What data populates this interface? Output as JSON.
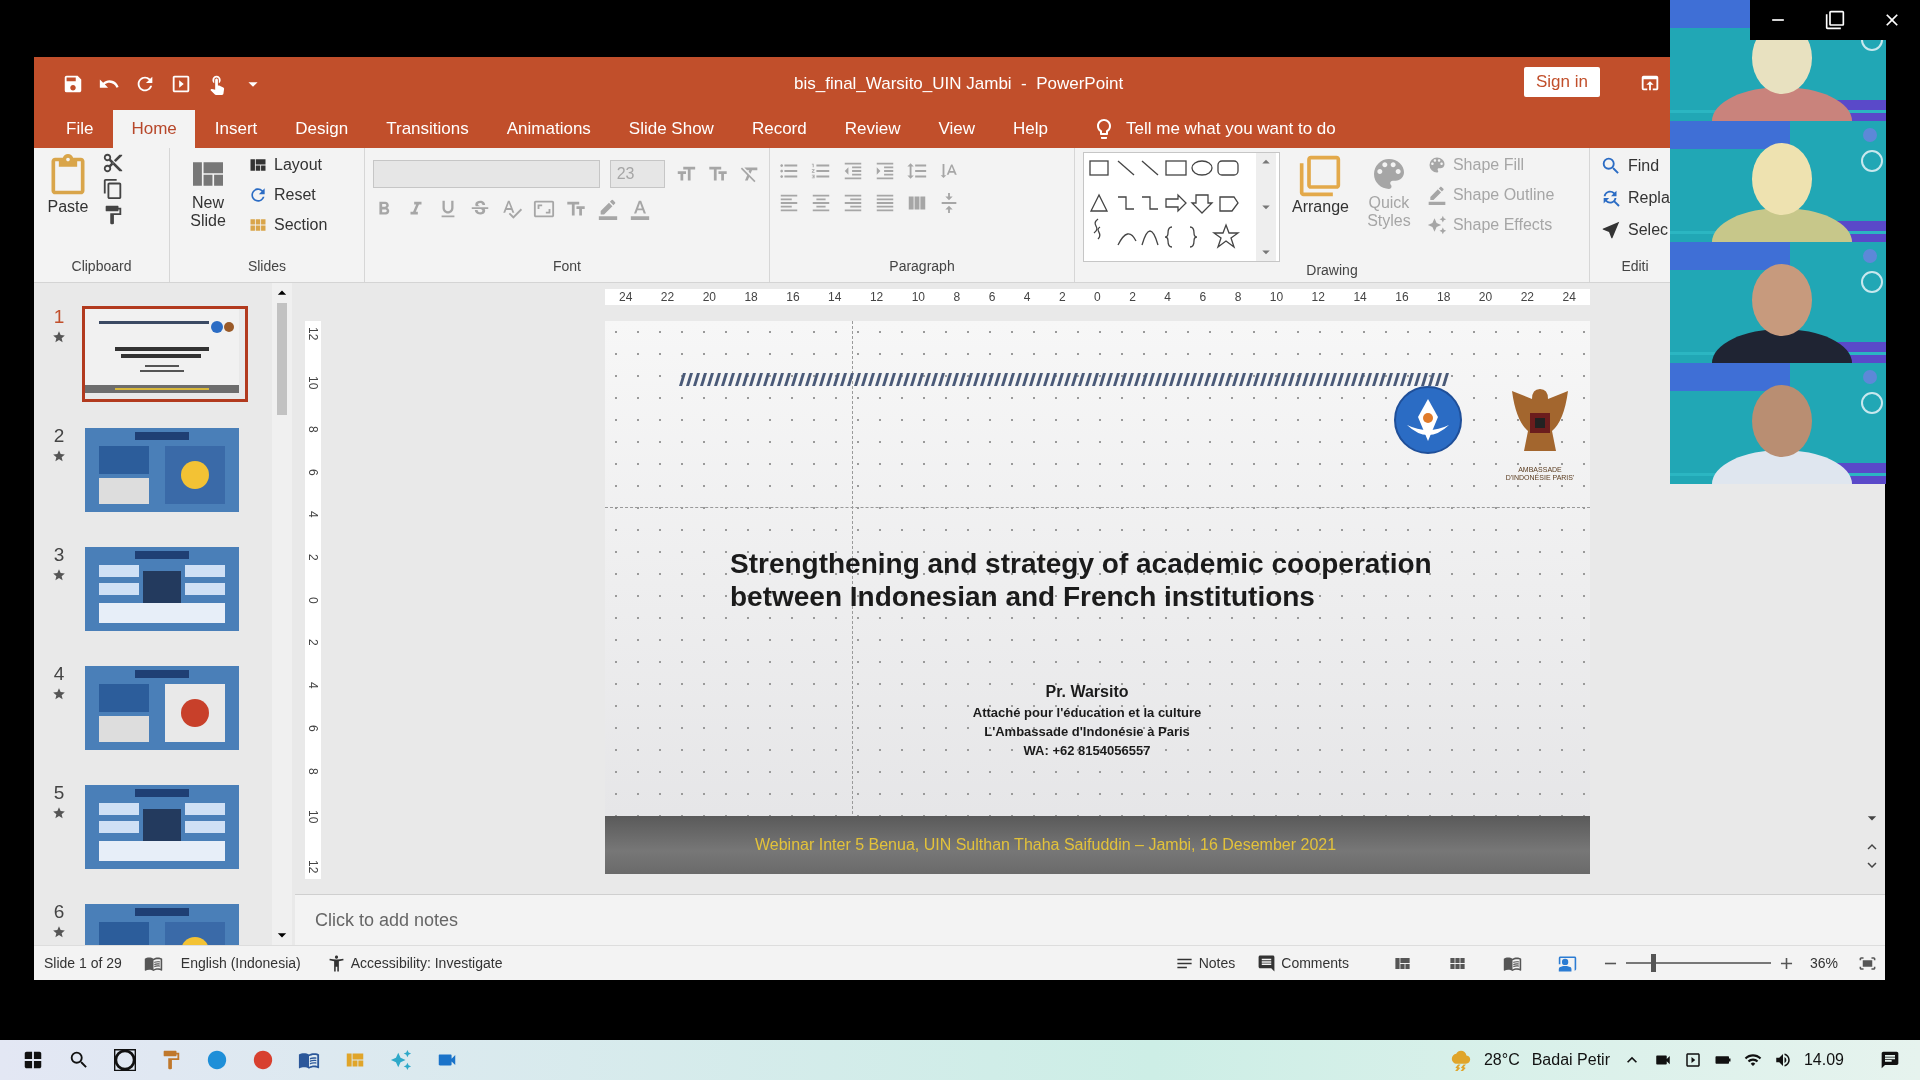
{
  "window": {
    "title": "bis_final_Warsito_UIN Jambi  -  PowerPoint",
    "sign_in": "Sign in"
  },
  "tabs": [
    {
      "label": "File",
      "selected": false
    },
    {
      "label": "Home",
      "selected": true
    },
    {
      "label": "Insert",
      "selected": false
    },
    {
      "label": "Design",
      "selected": false
    },
    {
      "label": "Transitions",
      "selected": false
    },
    {
      "label": "Animations",
      "selected": false
    },
    {
      "label": "Slide Show",
      "selected": false
    },
    {
      "label": "Record",
      "selected": false
    },
    {
      "label": "Review",
      "selected": false
    },
    {
      "label": "View",
      "selected": false
    },
    {
      "label": "Help",
      "selected": false
    }
  ],
  "tell_me": "Tell me what you want to do",
  "ribbon": {
    "clipboard": {
      "paste": "Paste",
      "label": "Clipboard"
    },
    "slides": {
      "new_slide": "New Slide",
      "layout": "Layout",
      "reset": "Reset",
      "section": "Section",
      "label": "Slides"
    },
    "font": {
      "size": "23",
      "disabled": true,
      "label": "Font"
    },
    "paragraph": {
      "disabled": true,
      "label": "Paragraph"
    },
    "drawing": {
      "arrange": "Arrange",
      "quick_styles": {
        "label": "Quick Styles",
        "disabled": true
      },
      "shape_format": [
        {
          "label": "Shape Fill",
          "disabled": true
        },
        {
          "label": "Shape Outline",
          "disabled": true
        },
        {
          "label": "Shape Effects",
          "disabled": true
        }
      ],
      "label": "Drawing"
    },
    "editing": {
      "items": [
        {
          "label": "Find",
          "kind": "find"
        },
        {
          "label": "Repla",
          "kind": "replace"
        },
        {
          "label": "Selec",
          "kind": "select"
        }
      ],
      "label": "Editi"
    }
  },
  "horizontal_ruler": [
    "24",
    "22",
    "20",
    "18",
    "16",
    "14",
    "12",
    "10",
    "8",
    "6",
    "4",
    "2",
    "0",
    "2",
    "4",
    "6",
    "8",
    "10",
    "12",
    "14",
    "16",
    "18",
    "20",
    "22",
    "24"
  ],
  "vertical_ruler": [
    "12",
    "10",
    "8",
    "6",
    "4",
    "2",
    "0",
    "2",
    "4",
    "6",
    "8",
    "10",
    "12"
  ],
  "slides_pane": [
    {
      "number": "1",
      "selected": true
    },
    {
      "number": "2",
      "selected": false
    },
    {
      "number": "3",
      "selected": false
    },
    {
      "number": "4",
      "selected": false
    },
    {
      "number": "5",
      "selected": false
    },
    {
      "number": "6",
      "selected": false
    }
  ],
  "slide": {
    "title": "Strengthening and strategy of academic cooperation between Indonesian and French institutions",
    "emblem_caption": "AMBASSADE D'INDONÉSIE PARIS'",
    "presenter": "Pr. Warsito",
    "details": [
      "Attaché pour l'éducation et la culture",
      "L'Ambassade d'Indonésie à Paris",
      "WA: +62 8154056557"
    ],
    "footer": "Webinar Inter 5 Benua, UIN Sulthan Thaha Saifuddin – Jambi, 16 Desember 2021"
  },
  "notes": {
    "placeholder": "Click to add notes"
  },
  "status_bar": {
    "slide": "Slide 1 of 29",
    "language": "English (Indonesia)",
    "accessibility": "Accessibility: Investigate",
    "notes": "Notes",
    "comments": "Comments",
    "zoom_slider": {
      "level": 0.17
    },
    "zoom": "36%"
  },
  "taskbar": {
    "temperature": "28°C",
    "weather": "Badai Petir",
    "time": "14.09"
  }
}
